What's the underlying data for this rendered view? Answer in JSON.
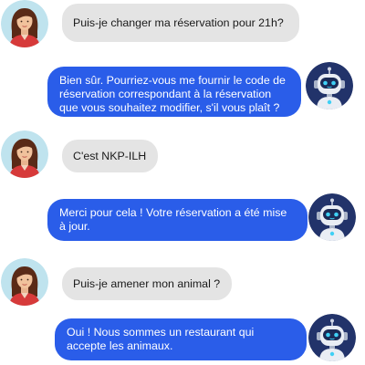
{
  "conversation": {
    "messages": [
      {
        "sender": "user",
        "text": "Puis-je changer ma réservation pour 21h?"
      },
      {
        "sender": "bot",
        "text": "Bien sûr. Pourriez-vous me fournir le code de réservation correspondant à la réservation que vous souhaitez modifier, s'il vous plaît ?"
      },
      {
        "sender": "user",
        "text": "C'est NKP-ILH"
      },
      {
        "sender": "bot",
        "text": "Merci pour cela ! Votre réservation a été mise à jour."
      },
      {
        "sender": "user",
        "text": "Puis-je amener mon animal ?"
      },
      {
        "sender": "bot",
        "text": "Oui ! Nous sommes un restaurant qui accepte les animaux."
      }
    ]
  },
  "colors": {
    "user_bubble": "#e4e4e4",
    "bot_bubble": "#2a5de9",
    "user_avatar_bg": "#bfe3ee",
    "bot_avatar_bg": "#22336a"
  },
  "icons": {
    "user_avatar": "woman-avatar-icon",
    "bot_avatar": "robot-avatar-icon"
  }
}
